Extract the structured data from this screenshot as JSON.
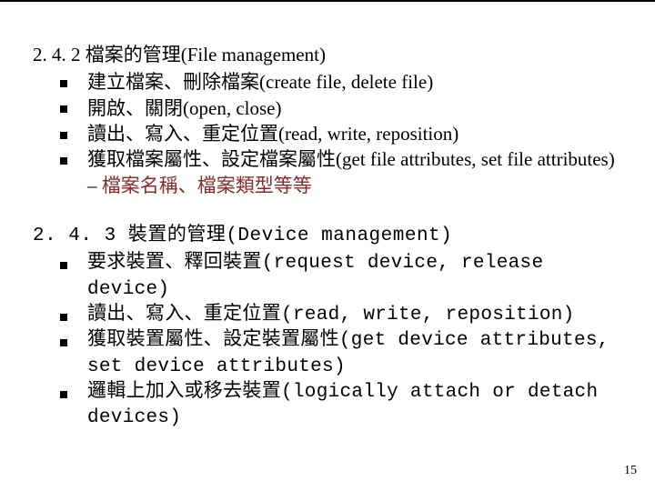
{
  "sections": [
    {
      "id": "s242",
      "mono": false,
      "heading": "2. 4. 2 檔案的管理(File management)",
      "items": [
        {
          "text": "建立檔案、刪除檔案(create file, delete file)"
        },
        {
          "text": "開啟、關閉(open, close)"
        },
        {
          "text": "讀出、寫入、重定位置(read, write, reposition)"
        },
        {
          "text": "獲取檔案屬性、設定檔案屬性(get file attributes, set file attributes) – ",
          "tail_maroon": "檔案名稱、檔案類型等等"
        }
      ]
    },
    {
      "id": "s243",
      "mono": true,
      "heading": "2. 4. 3 裝置的管理(Device management)",
      "items": [
        {
          "text": "要求裝置、釋回裝置(request device, release device)"
        },
        {
          "text": "讀出、寫入、重定位置(read, write, reposition)"
        },
        {
          "text": "獲取裝置屬性、設定裝置屬性(get device attributes, set device attributes)"
        },
        {
          "text": "邏輯上加入或移去裝置(logically attach or detach devices)"
        }
      ]
    }
  ],
  "page_number": "15"
}
